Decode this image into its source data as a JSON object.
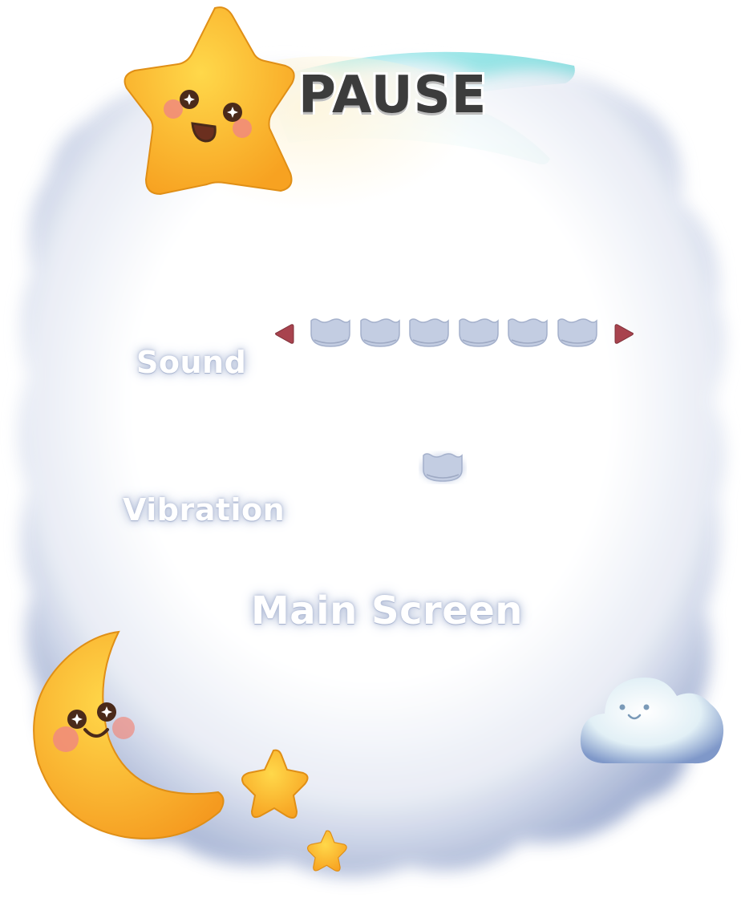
{
  "title": "PAUSE",
  "settings": {
    "sound_label": "Sound",
    "vibration_label": "Vibration",
    "sound_level": 0,
    "sound_steps": 6,
    "vibration_on": false
  },
  "menu": {
    "main_screen_label": "Main Screen"
  },
  "colors": {
    "ribbon": "#8fe4e6",
    "star": "#ffbf2f",
    "arrow": "#a8434e",
    "slot": "#c3cde2",
    "label_glow": "#b8c3dc"
  },
  "icons": {
    "title_mascot": "smiling-star-icon",
    "moon": "smiling-moon-icon",
    "small_stars": "star-icon",
    "small_cloud": "smiling-cloud-icon"
  }
}
